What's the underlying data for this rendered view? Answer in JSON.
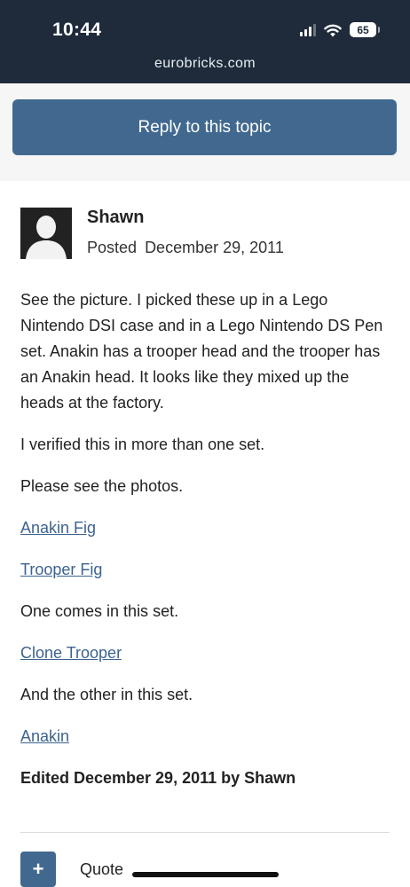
{
  "status_bar": {
    "time": "10:44",
    "battery": "65",
    "url": "eurobricks.com",
    "icons": [
      "signal-icon",
      "wifi-icon",
      "battery-icon"
    ]
  },
  "reply": {
    "button_label": "Reply to this topic",
    "color": "#41698f"
  },
  "post": {
    "author": "Shawn",
    "posted_label": "Posted",
    "posted_date": "December 29, 2011",
    "paragraphs": [
      "See the picture. I picked these up in a Lego Nintendo DSI case and in a Lego Nintendo DS Pen set. Anakin has a trooper head and the trooper has an Anakin head. It looks like they mixed up the heads at the factory.",
      "I verified this in more than one set.",
      "Please see the photos."
    ],
    "links": {
      "anakin_fig": "Anakin Fig",
      "trooper_fig": "Trooper Fig",
      "clone_trooper": "Clone Trooper",
      "anakin": "Anakin"
    },
    "one_comes": "One comes in this set.",
    "other_set": "And the other in this set.",
    "edited": "Edited December 29, 2011 by Shawn"
  },
  "actions": {
    "plus": "+",
    "quote_label": "Quote"
  },
  "colors": {
    "header_bg": "#1f2b3b",
    "link": "#3c6390"
  }
}
